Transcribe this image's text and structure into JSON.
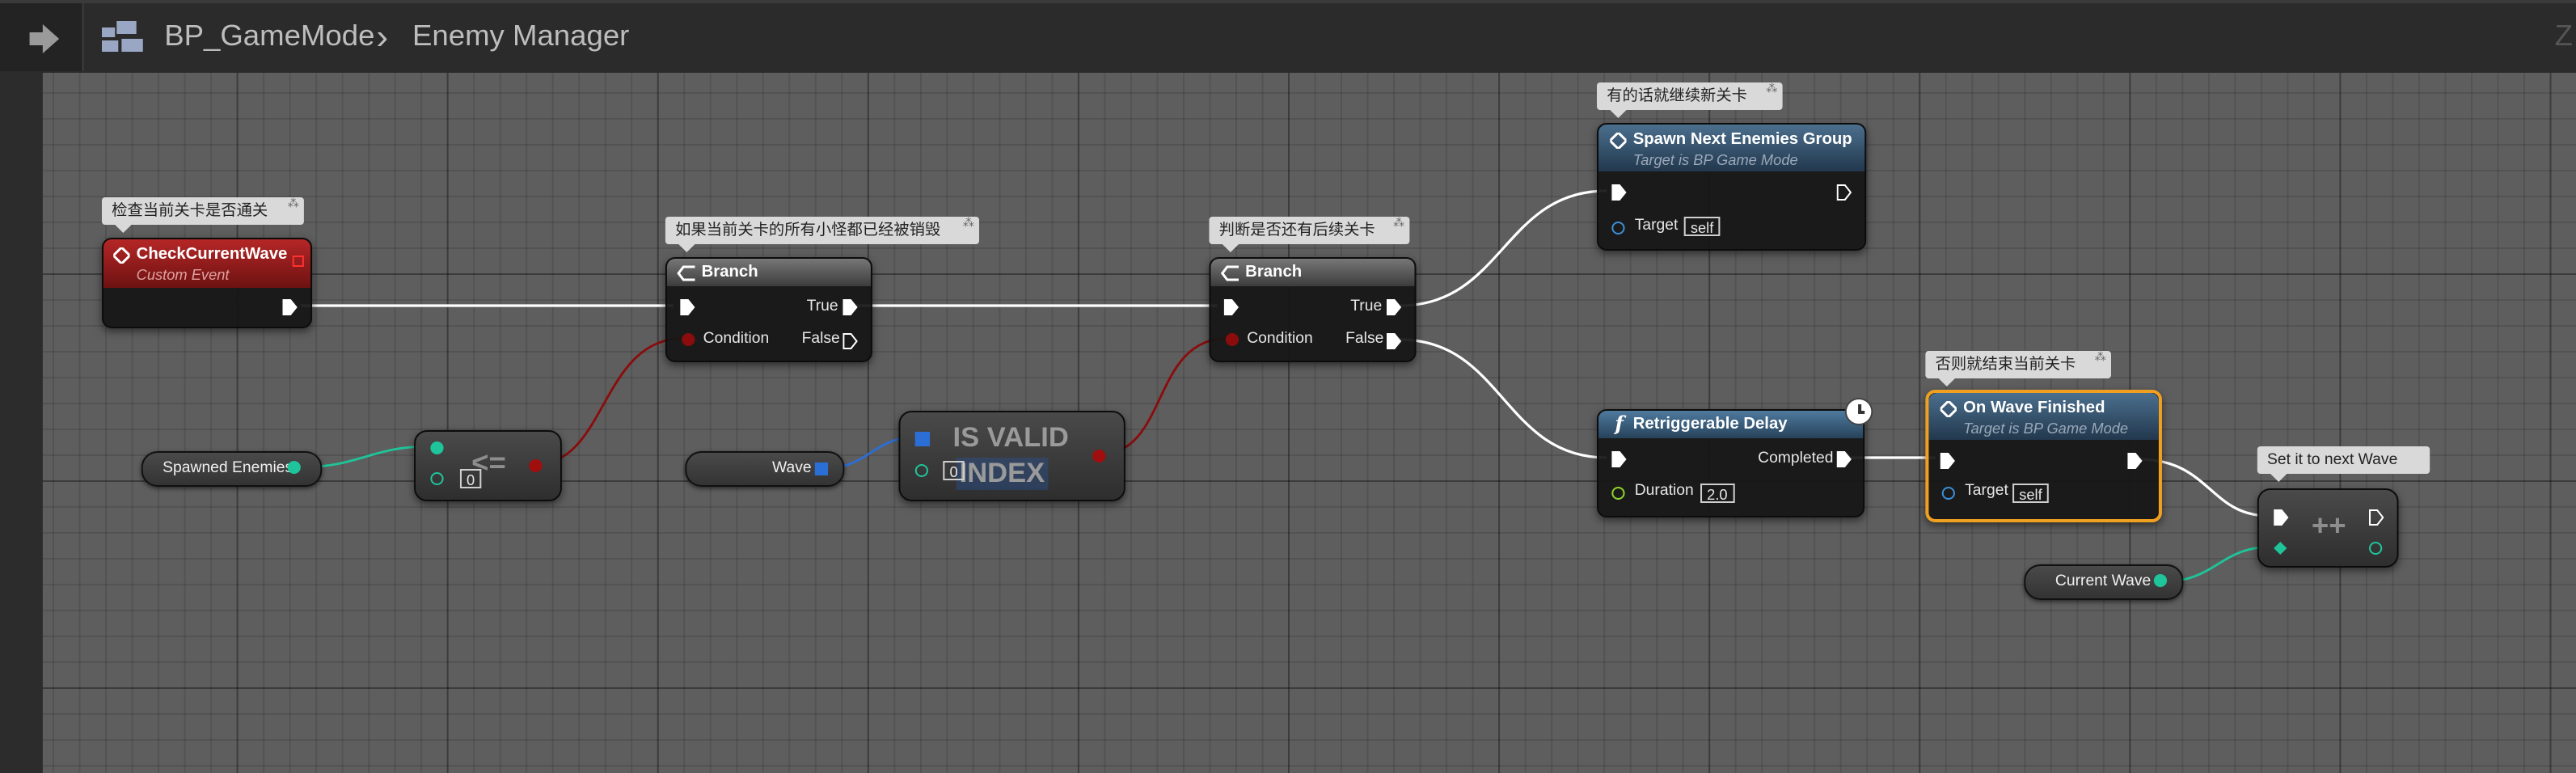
{
  "header": {
    "breadcrumb_root": "BP_GameMode",
    "separator": "›",
    "breadcrumb_current": "Enemy Manager",
    "right_fragment": "Z"
  },
  "comments": {
    "check_current": "检查当前关卡是否通关",
    "all_destroyed": "如果当前关卡的所有小怪都已经被销毁",
    "has_next": "判断是否还有后续关卡",
    "continue_next": "有的话就继续新关卡",
    "else_finish": "否则就结束当前关卡",
    "next_wave": "Set it to next Wave"
  },
  "nodes": {
    "check_current_wave": {
      "title": "CheckCurrentWave",
      "subtitle": "Custom Event"
    },
    "branch1": {
      "title": "Branch",
      "true_label": "True",
      "false_label": "False",
      "condition_label": "Condition"
    },
    "branch2": {
      "title": "Branch",
      "true_label": "True",
      "false_label": "False",
      "condition_label": "Condition"
    },
    "spawn_next": {
      "title": "Spawn Next Enemies Group",
      "subtitle": "Target is BP Game Mode",
      "target_label": "Target",
      "target_value": "self"
    },
    "retrigger_delay": {
      "title": "Retriggerable Delay",
      "completed_label": "Completed",
      "duration_label": "Duration",
      "duration_value": "2.0"
    },
    "on_wave_finished": {
      "title": "On Wave Finished",
      "subtitle": "Target is BP Game Mode",
      "target_label": "Target",
      "target_value": "self"
    },
    "less_equal": {
      "op": "<=",
      "value": "0"
    },
    "is_valid_index": {
      "title_line1": "IS VALID",
      "title_line2": "INDEX",
      "value": "0"
    },
    "increment": {
      "op": "++"
    },
    "var_spawned": {
      "label": "Spawned Enemies"
    },
    "var_wave": {
      "label": "Wave"
    },
    "var_current_wave": {
      "label": "Current Wave"
    }
  },
  "colors": {
    "event_red": "#8e1b1b",
    "wire_exec": "#ffffff",
    "wire_int": "#1fc49a",
    "wire_bool": "#8a0c0c",
    "wire_array": "#2b6fd6",
    "selected_border": "#f0a020"
  }
}
